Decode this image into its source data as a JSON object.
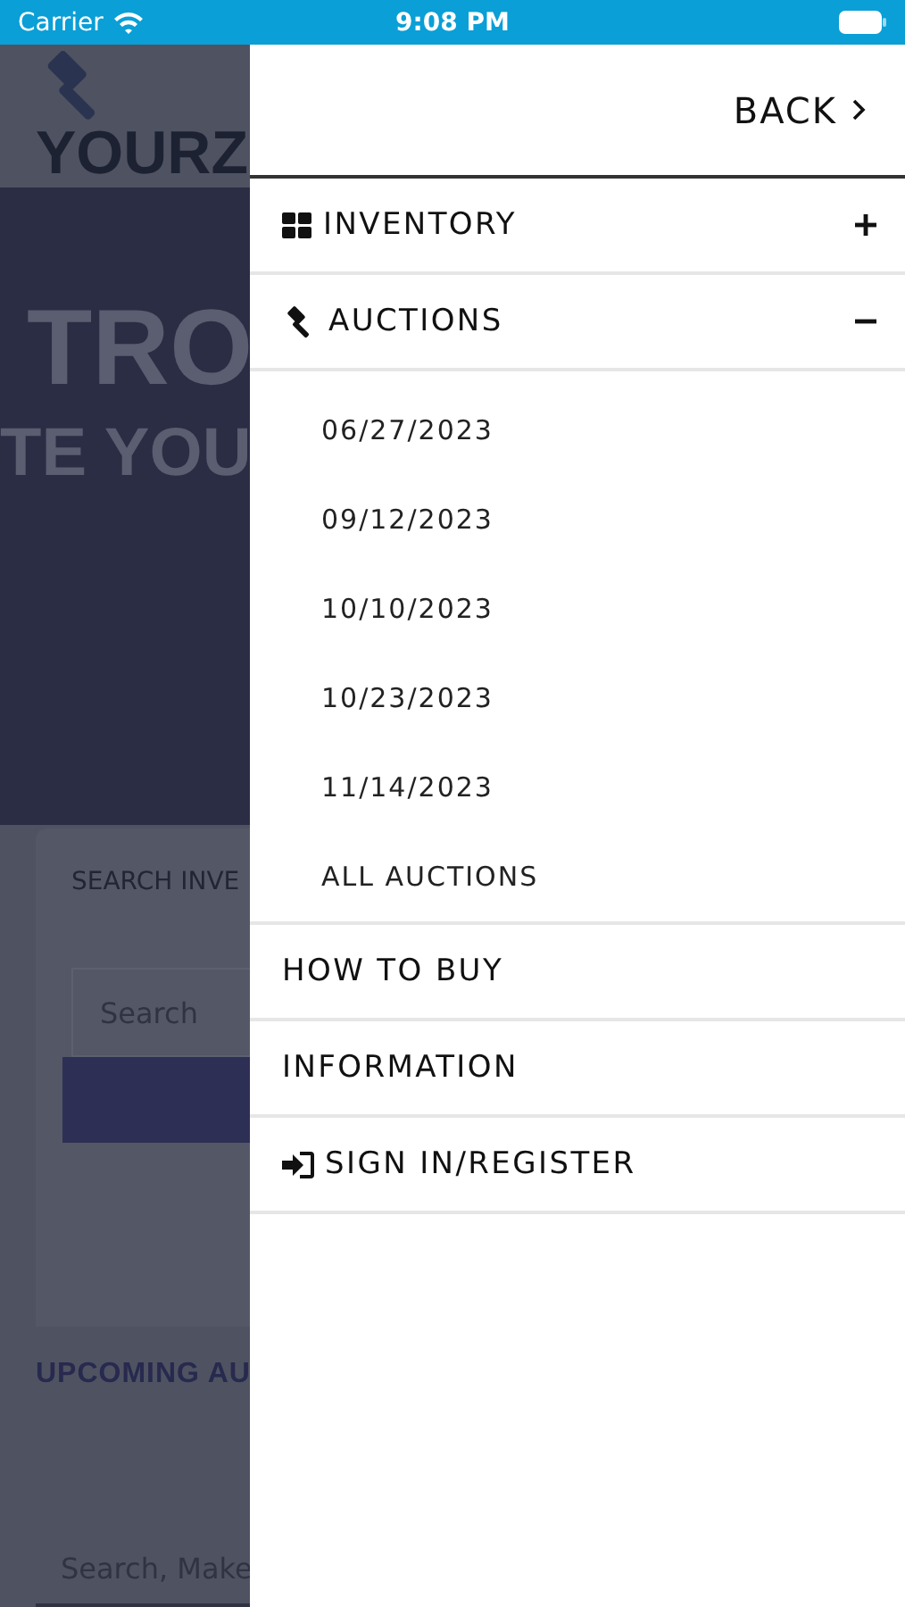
{
  "status_bar": {
    "carrier": "Carrier",
    "time": "9:08 PM"
  },
  "background_page": {
    "logo_text": "YOURZ",
    "hero_line_1": "TRO",
    "hero_line_2": "TE YOU",
    "search_tab": "SEARCH INVE",
    "search_placeholder": "Search",
    "upcoming_heading": "UPCOMING AU",
    "filter_placeholder": "Search, Make"
  },
  "drawer": {
    "back": "BACK",
    "items": [
      {
        "kind": "expandable",
        "label": "INVENTORY",
        "expanded": false
      },
      {
        "kind": "expandable",
        "label": "AUCTIONS",
        "expanded": true,
        "children": [
          {
            "label": "06/27/2023"
          },
          {
            "label": "09/12/2023"
          },
          {
            "label": "10/10/2023"
          },
          {
            "label": "10/23/2023"
          },
          {
            "label": "11/14/2023"
          },
          {
            "label": "ALL AUCTIONS"
          }
        ]
      },
      {
        "kind": "link",
        "label": "HOW TO BUY"
      },
      {
        "kind": "link",
        "label": "INFORMATION"
      },
      {
        "kind": "link",
        "label": "SIGN IN/REGISTER"
      }
    ]
  }
}
